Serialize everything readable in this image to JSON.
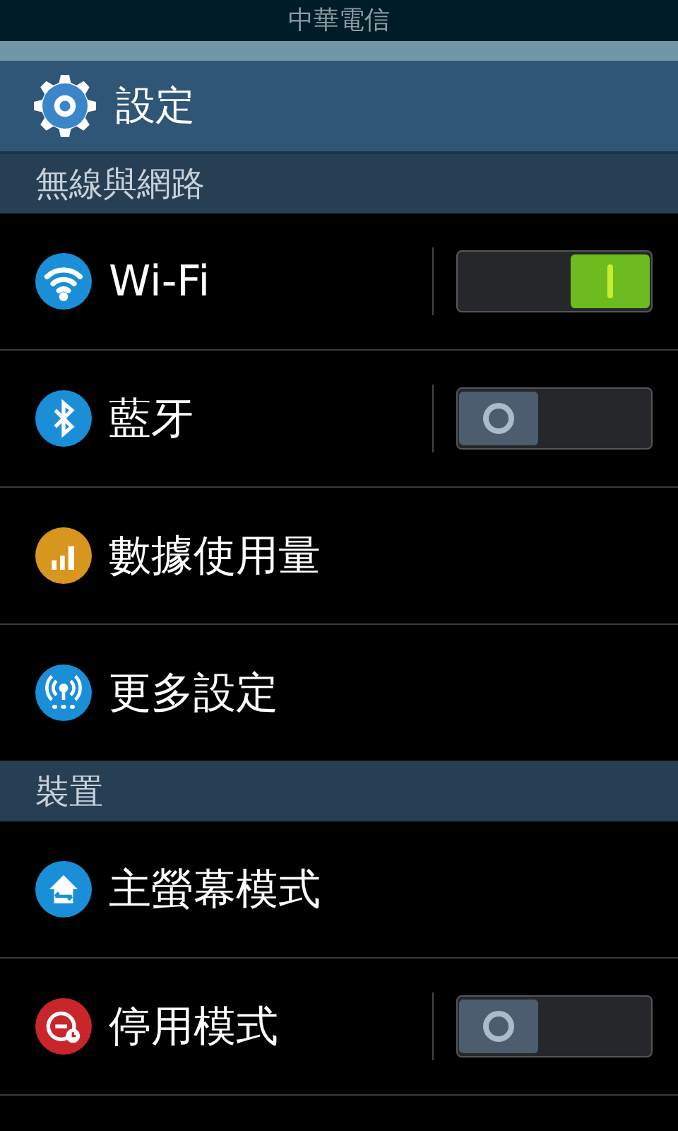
{
  "status_bar": {
    "carrier": "中華電信"
  },
  "header": {
    "title": "設定"
  },
  "sections": [
    {
      "title": "無線與網路",
      "items": [
        {
          "label": "Wi-Fi",
          "kind": "toggle",
          "on": true,
          "color": "#1a8fd8"
        },
        {
          "label": "藍牙",
          "kind": "toggle",
          "on": false,
          "color": "#1a8fd8"
        },
        {
          "label": "數據使用量",
          "kind": "plain",
          "color": "#d8961e"
        },
        {
          "label": "更多設定",
          "kind": "plain",
          "color": "#1a8fd8"
        }
      ]
    },
    {
      "title": "裝置",
      "items": [
        {
          "label": "主螢幕模式",
          "kind": "plain",
          "color": "#1a8fd8"
        },
        {
          "label": "停用模式",
          "kind": "toggle",
          "on": false,
          "color": "#c8262a"
        }
      ]
    }
  ]
}
